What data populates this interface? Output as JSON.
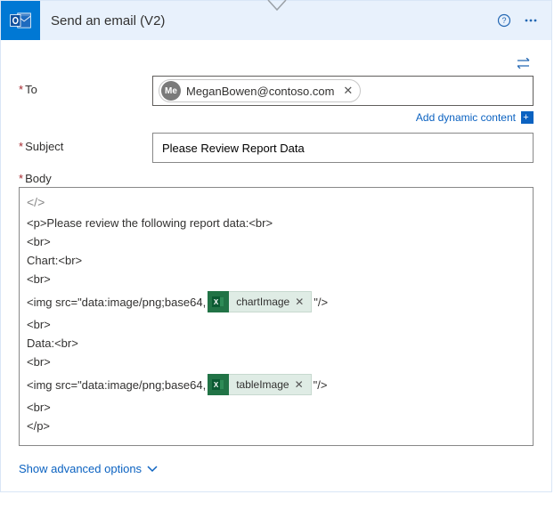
{
  "header": {
    "title": "Send an email (V2)"
  },
  "fields": {
    "to_label": "To",
    "to_chip_avatar": "Me",
    "to_chip_email": "MeganBowen@contoso.com",
    "dynamic_content": "Add dynamic content",
    "subject_label": "Subject",
    "subject_value": "Please Review Report Data",
    "body_label": "Body"
  },
  "body": {
    "codeview": "</>",
    "line1": "<p>Please review the following report data:<br>",
    "br": "<br>",
    "chart_label": "Chart:<br>",
    "img_prefix": "<img src=\"data:image/png;base64,",
    "img_suffix": "\"/>",
    "data_label": "Data:<br>",
    "close": "</p>",
    "token_chart": "chartImage",
    "token_table": "tableImage"
  },
  "footer": {
    "advanced": "Show advanced options"
  }
}
